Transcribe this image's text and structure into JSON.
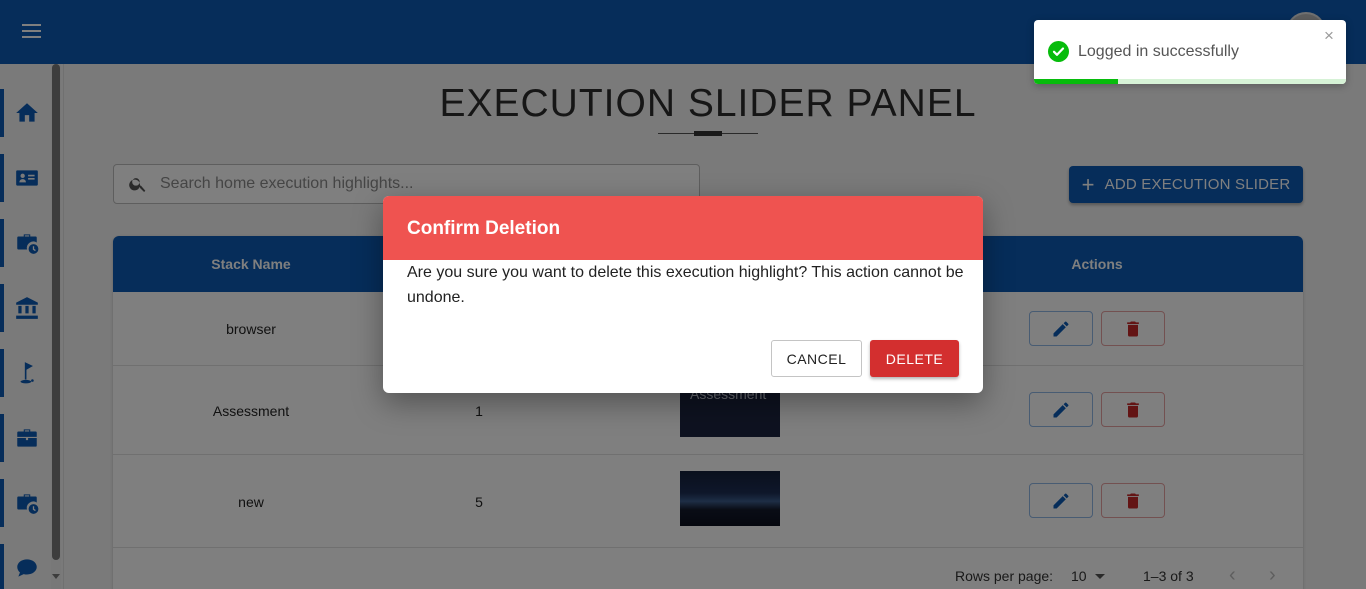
{
  "page": {
    "title": "EXECUTION SLIDER PANEL"
  },
  "search": {
    "placeholder": "Search home execution highlights...",
    "value": ""
  },
  "toolbar": {
    "add_label": "ADD EXECUTION SLIDER"
  },
  "sidebar": {
    "items": [
      {
        "icon": "home-icon"
      },
      {
        "icon": "id-card-icon"
      },
      {
        "icon": "briefcase-clock-icon"
      },
      {
        "icon": "bank-icon"
      },
      {
        "icon": "golf-flag-icon"
      },
      {
        "icon": "briefcase-icon"
      },
      {
        "icon": "briefcase-clock-icon"
      },
      {
        "icon": "chat-icon"
      }
    ]
  },
  "table": {
    "headers": {
      "stack_name": "Stack Name",
      "actions": "Actions"
    },
    "rows": [
      {
        "stack_name": "browser",
        "order": "",
        "image_alt": ""
      },
      {
        "stack_name": "Assessment",
        "order": "1",
        "image_alt": "Assessment"
      },
      {
        "stack_name": "new",
        "order": "5",
        "image_alt": ""
      }
    ],
    "footer": {
      "rows_per_page_label": "Rows per page:",
      "rows_per_page_value": "10",
      "page_count": "1–3 of 3"
    }
  },
  "dialog": {
    "title": "Confirm Deletion",
    "message": "Are you sure you want to delete this execution highlight? This action cannot be undone.",
    "cancel_label": "CANCEL",
    "delete_label": "DELETE"
  },
  "toast": {
    "message": "Logged in successfully",
    "close_glyph": "×",
    "progress": 0.27
  },
  "colors": {
    "primary": "#0d5bb5",
    "dialog_header": "#ef5350",
    "danger": "#d32f2f",
    "success": "#07bc0c"
  }
}
